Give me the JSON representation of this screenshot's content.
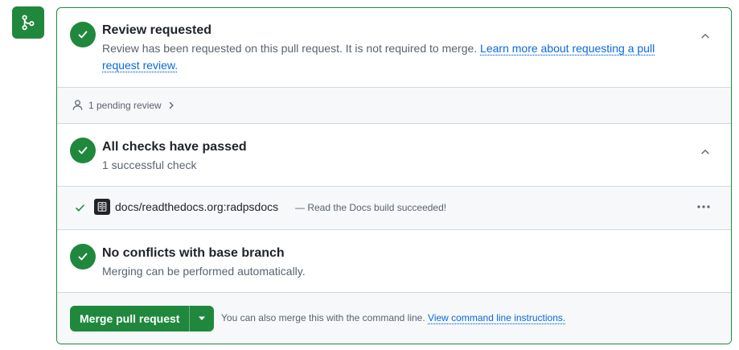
{
  "colors": {
    "success": "#1f883d",
    "link": "#0969da",
    "muted": "#59636e",
    "border": "#d1d9e0"
  },
  "icons": {
    "merge": "git-merge-icon",
    "status": "check-icon",
    "collapse": "chevron-up-icon",
    "person": "person-icon",
    "expand": "chevron-right-icon",
    "readthedocs": "readthedocs-logo",
    "more": "kebab-horizontal-icon",
    "dropdown": "triangle-down-icon"
  },
  "review": {
    "title": "Review requested",
    "description": "Review has been requested on this pull request. It is not required to merge.",
    "link": "Learn more about requesting a pull request review."
  },
  "pending": {
    "label": "1 pending review"
  },
  "checks": {
    "title": "All checks have passed",
    "summary": "1 successful check",
    "items": [
      {
        "name": "docs/readthedocs.org:radpsdocs",
        "status": "— Read the Docs build succeeded!"
      }
    ]
  },
  "conflicts": {
    "title": "No conflicts with base branch",
    "description": "Merging can be performed automatically."
  },
  "merge": {
    "button_label": "Merge pull request",
    "note": "You can also merge this with the command line.",
    "link": "View command line instructions."
  }
}
